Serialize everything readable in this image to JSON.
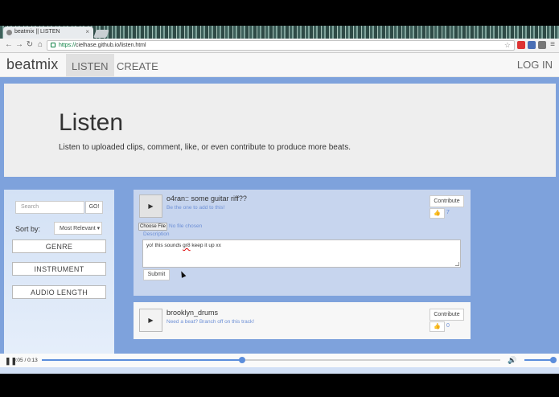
{
  "browser": {
    "tab_title": "beatmix || LISTEN",
    "url_scheme": "https://",
    "url_rest": "cielhase.github.io/listen.html",
    "colors": {
      "secure_green": "#0b8043"
    }
  },
  "nav": {
    "brand": "beatmix",
    "links": [
      "LISTEN",
      "CREATE"
    ],
    "login": "LOG IN"
  },
  "hero": {
    "title": "Listen",
    "subtitle": "Listen to uploaded clips, comment, like, or even contribute to produce more beats."
  },
  "sidebar": {
    "search_placeholder": "Search",
    "go_label": "GO!",
    "sort_label": "Sort by:",
    "sort_selected": "Most Relevant ▾",
    "filters": [
      "GENRE",
      "INSTRUMENT",
      "AUDIO LENGTH"
    ]
  },
  "tracks": [
    {
      "title": "o4ran:: some guitar riff??",
      "subtitle": "Be the one to add to this!",
      "contribute_label": "Contribute",
      "likes": "7",
      "choose_file_label": "Choose File",
      "no_file_label": "No file chosen",
      "description_label": "Description",
      "comment_pre": "yo! this sounds ",
      "comment_misspelt": "gr8",
      "comment_post": " keep it up xx",
      "submit_label": "Submit"
    },
    {
      "title": "brooklyn_drums",
      "subtitle": "Need a beat? Branch off on this track!",
      "contribute_label": "Contribute",
      "likes": "0"
    }
  ],
  "player": {
    "time": "0:05 / 0:13",
    "progress_fraction": 0.4375,
    "accent": "#5b8ddb"
  },
  "icons": {
    "play": "▶",
    "pause": "❚❚",
    "thumbs_up": "👍",
    "volume": "🔊"
  }
}
